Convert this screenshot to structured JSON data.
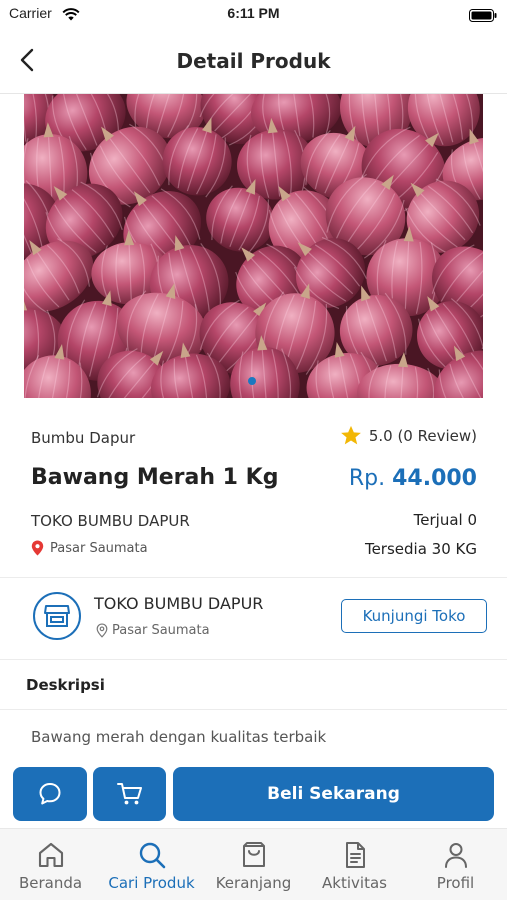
{
  "status_bar": {
    "carrier": "Carrier",
    "time": "6:11 PM"
  },
  "header": {
    "title": "Detail Produk"
  },
  "product": {
    "category": "Bumbu Dapur",
    "rating_text": "5.0 (0 Review)",
    "name": "Bawang Merah 1 Kg",
    "price_prefix": "Rp.",
    "price_value": "44.000",
    "shop_name": "TOKO BUMBU DAPUR",
    "location": "Pasar Saumata",
    "sold": "Terjual 0",
    "stock": "Tersedia 30 KG"
  },
  "shop": {
    "name": "TOKO BUMBU DAPUR",
    "location": "Pasar Saumata",
    "visit_label": "Kunjungi Toko"
  },
  "description": {
    "title": "Deskripsi",
    "text": "Bawang merah dengan kualitas terbaik"
  },
  "actions": {
    "buy_label": "Beli Sekarang"
  },
  "nav": [
    {
      "label": "Beranda",
      "icon": "home-icon",
      "active": false
    },
    {
      "label": "Cari Produk",
      "icon": "search-icon",
      "active": true
    },
    {
      "label": "Keranjang",
      "icon": "basket-icon",
      "active": false
    },
    {
      "label": "Aktivitas",
      "icon": "document-icon",
      "active": false
    },
    {
      "label": "Profil",
      "icon": "person-icon",
      "active": false
    }
  ],
  "colors": {
    "accent": "#1c6fb8",
    "star": "#f2b705",
    "pin": "#e53935"
  }
}
